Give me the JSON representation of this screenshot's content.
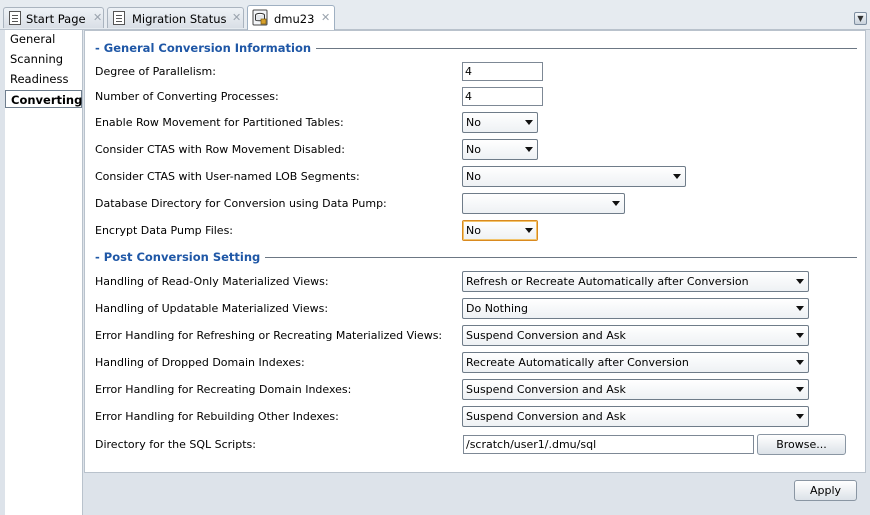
{
  "tabs": [
    {
      "label": "Start Page",
      "icon": "document-icon"
    },
    {
      "label": "Migration Status",
      "icon": "document-icon"
    },
    {
      "label": "dmu23",
      "icon": "database-icon"
    }
  ],
  "close_glyph": "✕",
  "nav": {
    "items": [
      "General",
      "Scanning",
      "Readiness",
      "Converting"
    ],
    "selected": "Converting"
  },
  "general": {
    "title": "General Conversion Information",
    "parallelism": {
      "label": "Degree of Parallelism:",
      "value": "4"
    },
    "processes": {
      "label": "Number of Converting Processes:",
      "value": "4"
    },
    "row_movement": {
      "label": "Enable Row Movement for Partitioned Tables:",
      "value": "No"
    },
    "ctas_row_movement": {
      "label": "Consider CTAS with Row Movement Disabled:",
      "value": "No"
    },
    "ctas_lob": {
      "label": "Consider CTAS with User-named LOB Segments:",
      "value": "No"
    },
    "db_directory": {
      "label": "Database Directory for Conversion using Data Pump:",
      "value": ""
    },
    "encrypt": {
      "label": "Encrypt Data Pump Files:",
      "value": "No"
    }
  },
  "post": {
    "title": "Post Conversion Setting",
    "readonly_mv": {
      "label": "Handling of Read-Only Materialized Views:",
      "value": "Refresh or Recreate Automatically after Conversion"
    },
    "updatable_mv": {
      "label": "Handling of Updatable Materialized Views:",
      "value": "Do Nothing"
    },
    "error_mv": {
      "label": "Error Handling for Refreshing or Recreating Materialized Views:",
      "value": "Suspend Conversion and Ask"
    },
    "dropped_idx": {
      "label": "Handling of Dropped Domain Indexes:",
      "value": "Recreate Automatically after Conversion"
    },
    "error_domain_idx": {
      "label": "Error Handling for Recreating Domain Indexes:",
      "value": "Suspend Conversion and Ask"
    },
    "error_other_idx": {
      "label": "Error Handling for Rebuilding Other Indexes:",
      "value": "Suspend Conversion and Ask"
    },
    "sql_dir": {
      "label": "Directory for the SQL Scripts:",
      "value": "/scratch/user1/.dmu/sql"
    },
    "browse": "Browse..."
  },
  "apply": "Apply"
}
